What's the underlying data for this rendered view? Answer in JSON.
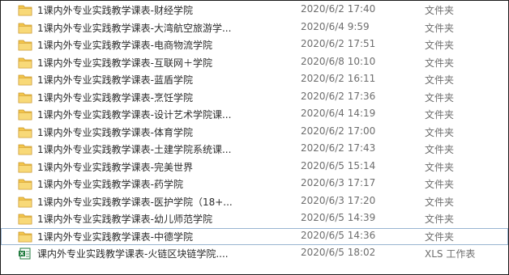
{
  "file_list": {
    "rows": [
      {
        "name": "1课内外专业实践教学课表-财经学院",
        "date": "2020/6/2 17:40",
        "type": "文件夹",
        "icon": "folder-icon"
      },
      {
        "name": "1课内外专业实践教学课表-大湾航空旅游学...",
        "date": "2020/6/4 9:59",
        "type": "文件夹",
        "icon": "folder-icon"
      },
      {
        "name": "1课内外专业实践教学课表-电商物流学院",
        "date": "2020/6/2 17:51",
        "type": "文件夹",
        "icon": "folder-icon"
      },
      {
        "name": "1课内外专业实践教学课表-互联网＋学院",
        "date": "2020/6/8 10:10",
        "type": "文件夹",
        "icon": "folder-icon"
      },
      {
        "name": "1课内外专业实践教学课表-蓝盾学院",
        "date": "2020/6/2 16:11",
        "type": "文件夹",
        "icon": "folder-icon"
      },
      {
        "name": "1课内外专业实践教学课表-烹饪学院",
        "date": "2020/6/2 17:36",
        "type": "文件夹",
        "icon": "folder-icon"
      },
      {
        "name": "1课内外专业实践教学课表-设计艺术学院课...",
        "date": "2020/6/4 14:19",
        "type": "文件夹",
        "icon": "folder-icon"
      },
      {
        "name": "1课内外专业实践教学课表-体育学院",
        "date": "2020/6/2 17:00",
        "type": "文件夹",
        "icon": "folder-icon"
      },
      {
        "name": "1课内外专业实践教学课表-土建学院系统课...",
        "date": "2020/6/2 17:43",
        "type": "文件夹",
        "icon": "folder-icon"
      },
      {
        "name": "1课内外专业实践教学课表-完美世界",
        "date": "2020/6/5 15:14",
        "type": "文件夹",
        "icon": "folder-icon"
      },
      {
        "name": "1课内外专业实践教学课表-药学院",
        "date": "2020/6/3 17:17",
        "type": "文件夹",
        "icon": "folder-icon"
      },
      {
        "name": "1课内外专业实践教学课表-医护学院（18+...",
        "date": "2020/6/3 17:20",
        "type": "文件夹",
        "icon": "folder-icon"
      },
      {
        "name": "1课内外专业实践教学课表-幼儿师范学院",
        "date": "2020/6/5 14:39",
        "type": "文件夹",
        "icon": "folder-icon"
      },
      {
        "name": "1课内外专业实践教学课表-中德学院",
        "date": "2020/6/5 14:36",
        "type": "文件夹",
        "icon": "folder-icon",
        "selected": true
      },
      {
        "name": "课内外专业实践教学课表-火链区块链学院....",
        "date": "2020/6/5 18:02",
        "type": "XLS 工作表",
        "icon": "excel-file-icon"
      }
    ]
  },
  "colors": {
    "folder_body": "#f3c54a",
    "folder_front": "#f8d978",
    "folder_edge": "#c9962b",
    "excel_green": "#1f7a3d",
    "selection_outline": "#99b4d1"
  }
}
